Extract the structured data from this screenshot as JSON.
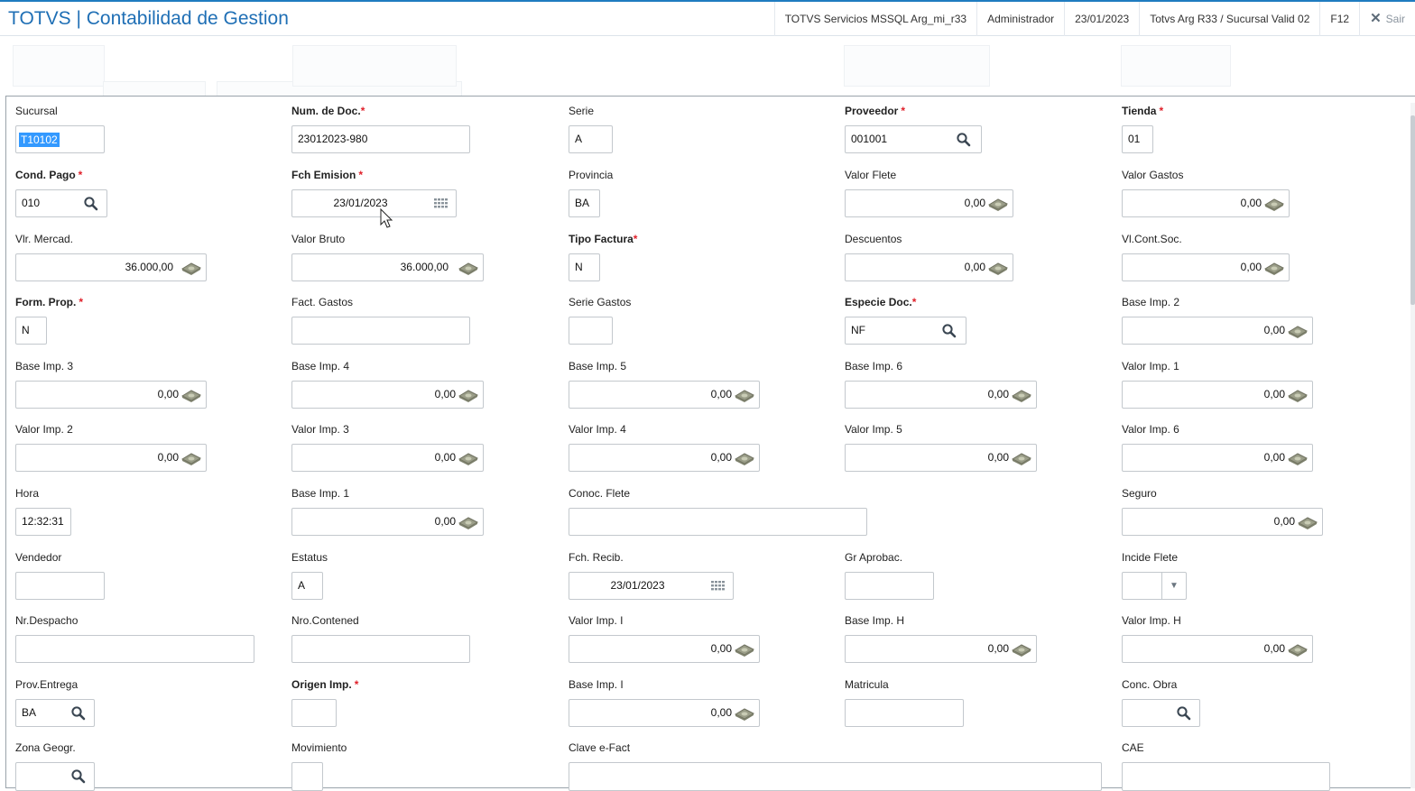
{
  "header": {
    "app_title": "TOTVS | Contabilidad de Gestion",
    "server": "TOTVS Servicios MSSQL Arg_mi_r33",
    "user": "Administrador",
    "date": "23/01/2023",
    "branch": "Totvs Arg R33 / Sucursal Valid 02",
    "shortcut": "F12",
    "exit": "Sair"
  },
  "form": {
    "sucursal": {
      "label": "Sucursal",
      "value": "T10102"
    },
    "num_doc": {
      "label": "Num. de Doc.",
      "value": "23012023-980"
    },
    "serie": {
      "label": "Serie",
      "value": "A"
    },
    "proveedor": {
      "label": "Proveedor",
      "value": "001001"
    },
    "tienda": {
      "label": "Tienda",
      "value": "01"
    },
    "cond_pago": {
      "label": "Cond. Pago",
      "value": "010"
    },
    "fch_emision": {
      "label": "Fch Emision",
      "value": "23/01/2023"
    },
    "provincia": {
      "label": "Provincia",
      "value": "BA"
    },
    "valor_flete": {
      "label": "Valor Flete",
      "value": "0,00"
    },
    "valor_gastos": {
      "label": "Valor Gastos",
      "value": "0,00"
    },
    "vlr_mercad": {
      "label": "Vlr. Mercad.",
      "value": "36.000,00"
    },
    "valor_bruto": {
      "label": "Valor Bruto",
      "value": "36.000,00"
    },
    "tipo_factura": {
      "label": "Tipo Factura",
      "value": "N"
    },
    "descuentos": {
      "label": "Descuentos",
      "value": "0,00"
    },
    "vl_cont_soc": {
      "label": "Vl.Cont.Soc.",
      "value": "0,00"
    },
    "form_prop": {
      "label": "Form. Prop.",
      "value": "N"
    },
    "fact_gastos": {
      "label": "Fact. Gastos",
      "value": ""
    },
    "serie_gastos": {
      "label": "Serie Gastos",
      "value": ""
    },
    "especie_doc": {
      "label": "Especie Doc.",
      "value": "NF"
    },
    "base_imp_2": {
      "label": "Base Imp. 2",
      "value": "0,00"
    },
    "base_imp_3": {
      "label": "Base Imp. 3",
      "value": "0,00"
    },
    "base_imp_4": {
      "label": "Base Imp. 4",
      "value": "0,00"
    },
    "base_imp_5": {
      "label": "Base Imp. 5",
      "value": "0,00"
    },
    "base_imp_6": {
      "label": "Base Imp. 6",
      "value": "0,00"
    },
    "valor_imp_1": {
      "label": "Valor Imp. 1",
      "value": "0,00"
    },
    "valor_imp_2": {
      "label": "Valor Imp. 2",
      "value": "0,00"
    },
    "valor_imp_3": {
      "label": "Valor Imp. 3",
      "value": "0,00"
    },
    "valor_imp_4": {
      "label": "Valor Imp. 4",
      "value": "0,00"
    },
    "valor_imp_5": {
      "label": "Valor Imp. 5",
      "value": "0,00"
    },
    "valor_imp_6": {
      "label": "Valor Imp. 6",
      "value": "0,00"
    },
    "hora": {
      "label": "Hora",
      "value": "12:32:31"
    },
    "base_imp_1": {
      "label": "Base Imp. 1",
      "value": "0,00"
    },
    "conoc_flete": {
      "label": "Conoc. Flete",
      "value": ""
    },
    "seguro": {
      "label": "Seguro",
      "value": "0,00"
    },
    "vendedor": {
      "label": "Vendedor",
      "value": ""
    },
    "estatus": {
      "label": "Estatus",
      "value": "A"
    },
    "fch_recib": {
      "label": "Fch. Recib.",
      "value": "23/01/2023"
    },
    "gr_aprobac": {
      "label": "Gr Aprobac.",
      "value": ""
    },
    "incide_flete": {
      "label": "Incide Flete",
      "value": ""
    },
    "nr_despacho": {
      "label": "Nr.Despacho",
      "value": ""
    },
    "nro_contened": {
      "label": "Nro.Contened",
      "value": ""
    },
    "valor_imp_i": {
      "label": "Valor Imp. I",
      "value": "0,00"
    },
    "base_imp_h": {
      "label": "Base Imp. H",
      "value": "0,00"
    },
    "valor_imp_h": {
      "label": "Valor Imp. H",
      "value": "0,00"
    },
    "prov_entrega": {
      "label": "Prov.Entrega",
      "value": "BA"
    },
    "origen_imp": {
      "label": "Origen Imp.",
      "value": ""
    },
    "base_imp_i": {
      "label": "Base Imp. I",
      "value": "0,00"
    },
    "matricula": {
      "label": "Matricula",
      "value": ""
    },
    "conc_obra": {
      "label": "Conc. Obra",
      "value": ""
    },
    "zona_geogr": {
      "label": "Zona Geogr.",
      "value": ""
    },
    "movimiento": {
      "label": "Movimiento",
      "value": ""
    },
    "clave_efact": {
      "label": "Clave e-Fact",
      "value": ""
    },
    "cae": {
      "label": "CAE",
      "value": ""
    }
  },
  "colors": {
    "brand": "#1f6fb5",
    "required": "#e0202a",
    "selection": "#3399ff"
  },
  "icons": {
    "lookup": "magnifier-icon",
    "calc": "calculator-icon",
    "calendar": "calendar-icon",
    "dropdown": "chevron-down-icon",
    "close": "close-icon"
  }
}
